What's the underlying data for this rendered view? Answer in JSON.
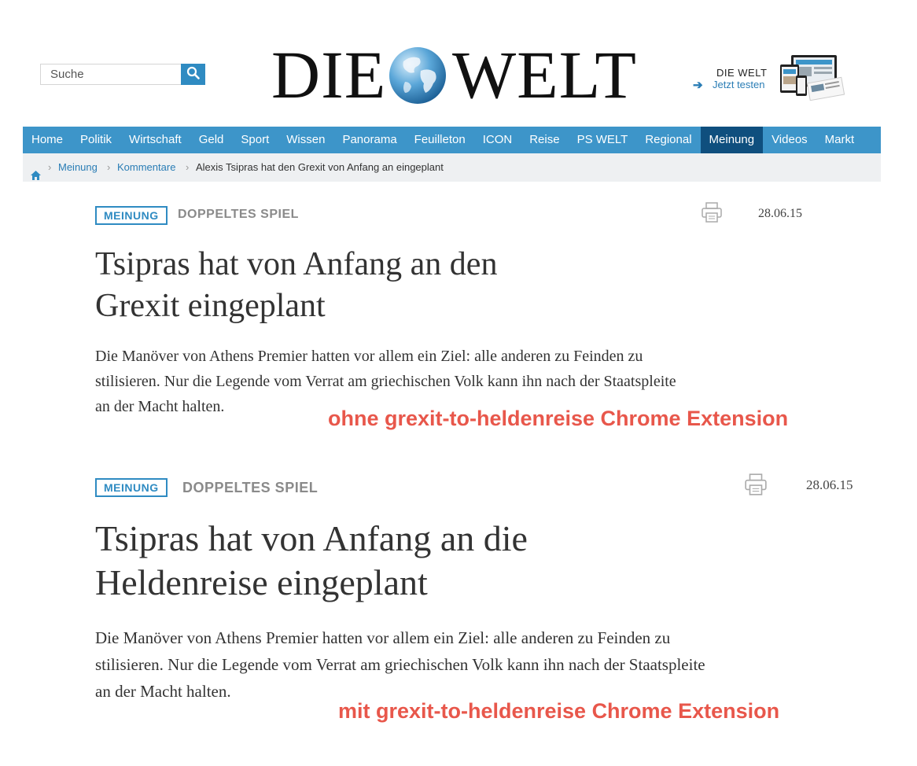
{
  "search": {
    "placeholder": "Suche"
  },
  "logo": {
    "left_word": "DIE",
    "right_word": "WELT"
  },
  "promo": {
    "line1": "DIE WELT",
    "line2": "Jetzt testen"
  },
  "nav": {
    "items": [
      "Home",
      "Politik",
      "Wirtschaft",
      "Geld",
      "Sport",
      "Wissen",
      "Panorama",
      "Feuilleton",
      "ICON",
      "Reise",
      "PS WELT",
      "Regional",
      "Meinung",
      "Videos",
      "Markt"
    ],
    "active": "Meinung"
  },
  "breadcrumb": {
    "items": [
      "Meinung",
      "Kommentare"
    ],
    "current": "Alexis Tsipras hat den Grexit von Anfang an eingeplant"
  },
  "articles": [
    {
      "badge": "MEINUNG",
      "kicker": "DOPPELTES SPIEL",
      "date": "28.06.15",
      "headline_line1": "Tsipras hat von Anfang an den",
      "headline_line2": "Grexit eingeplant",
      "lead_line1": "Die Manöver von Athens Premier hatten vor allem ein Ziel: alle anderen zu Feinden zu",
      "lead_line2": "stilisieren. Nur die Legende vom Verrat am griechischen Volk kann ihn nach der Staatspleite",
      "lead_line3": "an der Macht halten.",
      "caption": "ohne grexit-to-heldenreise Chrome Extension"
    },
    {
      "badge": "MEINUNG",
      "kicker": "DOPPELTES SPIEL",
      "date": "28.06.15",
      "headline_line1": "Tsipras hat von Anfang an die",
      "headline_line2": "Heldenreise eingeplant",
      "lead_line1": "Die Manöver von Athens Premier hatten vor allem ein Ziel: alle anderen zu Feinden zu",
      "lead_line2": "stilisieren. Nur die Legende vom Verrat am griechischen Volk kann ihn nach der Staatspleite",
      "lead_line3": "an der Macht halten.",
      "caption": "mit grexit-to-heldenreise Chrome Extension"
    }
  ],
  "colors": {
    "nav": "#3d95c9",
    "nav_active": "#0f4f7e",
    "accent": "#2f8bc2",
    "caption": "#e8574b"
  },
  "icons": [
    "search-icon",
    "globe-icon",
    "arrow-right-icon",
    "devices-icon",
    "home-icon",
    "print-icon"
  ]
}
